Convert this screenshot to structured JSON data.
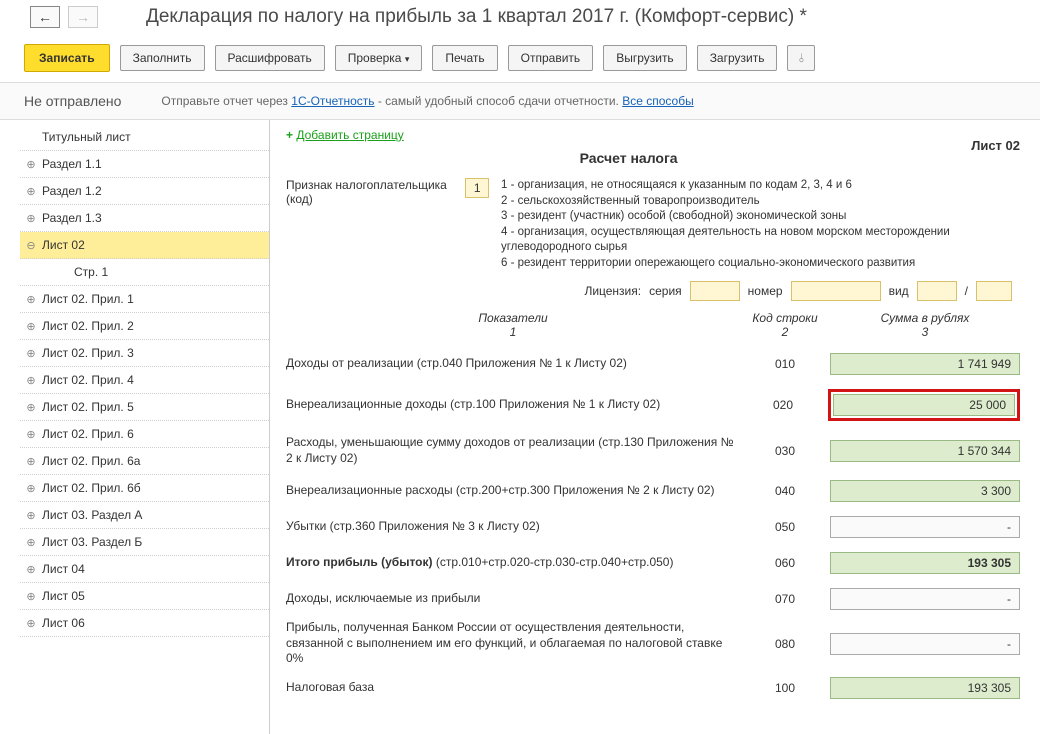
{
  "header": {
    "title": "Декларация по налогу на прибыль за 1 квартал 2017 г. (Комфорт-сервис) *"
  },
  "toolbar": {
    "save": "Записать",
    "fill": "Заполнить",
    "decode": "Расшифровать",
    "check": "Проверка",
    "print": "Печать",
    "send": "Отправить",
    "export": "Выгрузить",
    "import": "Загрузить"
  },
  "status": {
    "left": "Не отправлено",
    "text1": "Отправьте отчет через ",
    "link1": "1С-Отчетность",
    "text2": " - самый удобный способ сдачи отчетности. ",
    "link2": "Все способы"
  },
  "sidebar": {
    "items": [
      "Титульный лист",
      "Раздел 1.1",
      "Раздел 1.2",
      "Раздел 1.3",
      "Лист 02",
      "Стр. 1",
      "Лист 02. Прил. 1",
      "Лист 02. Прил. 2",
      "Лист 02. Прил. 3",
      "Лист 02. Прил. 4",
      "Лист 02. Прил. 5",
      "Лист 02. Прил. 6",
      "Лист 02. Прил. 6а",
      "Лист 02. Прил. 6б",
      "Лист 03. Раздел А",
      "Лист 03. Раздел Б",
      "Лист 04",
      "Лист 05",
      "Лист 06"
    ]
  },
  "content": {
    "add_page": "Добавить страницу",
    "sheet_label": "Лист 02",
    "section_title": "Расчет налога",
    "taxpayer_label": "Признак налогоплательщика (код)",
    "taxpayer_code": "1",
    "codes": {
      "l1": "1 - организация, не относящаяся к указанным по кодам 2, 3, 4 и 6",
      "l2": "2 - сельскохозяйственный товаропроизводитель",
      "l3": "3 - резидент (участник) особой (свободной) экономической зоны",
      "l4": "4 - организация, осуществляющая деятельность на новом морском месторождении углеводородного сырья",
      "l6": "6 - резидент территории опережающего социально-экономического развития"
    },
    "license": {
      "label": "Лицензия:",
      "series": "серия",
      "number": "номер",
      "kind": "вид",
      "slash": "/"
    },
    "colheaders": {
      "c1a": "Показатели",
      "c1b": "1",
      "c2a": "Код строки",
      "c2b": "2",
      "c3a": "Сумма в рублях",
      "c3b": "3"
    },
    "rows": [
      {
        "desc": "Доходы от реализации (стр.040 Приложения № 1 к Листу 02)",
        "code": "010",
        "val": "1 741 949",
        "style": "g"
      },
      {
        "desc": "Внереализационные доходы (стр.100 Приложения № 1 к Листу 02)",
        "code": "020",
        "val": "25 000",
        "style": "hl"
      },
      {
        "desc": "Расходы, уменьшающие сумму доходов от реализации (стр.130 Приложения № 2 к Листу 02)",
        "code": "030",
        "val": "1 570 344",
        "style": "g"
      },
      {
        "desc": "Внереализационные расходы (стр.200+стр.300 Приложения № 2 к Листу 02)",
        "code": "040",
        "val": "3 300",
        "style": "g"
      },
      {
        "desc": "Убытки (стр.360 Приложения № 3 к Листу 02)",
        "code": "050",
        "val": "-",
        "style": "l"
      },
      {
        "desc": "Итого прибыль (убыток)  (стр.010+стр.020-стр.030-стр.040+стр.050)",
        "code": "060",
        "val": "193 305",
        "style": "g",
        "bold": true
      },
      {
        "desc": "Доходы, исключаемые из прибыли",
        "code": "070",
        "val": "-",
        "style": "l"
      },
      {
        "desc": "Прибыль, полученная Банком России от осуществления деятельности, связанной с выполнением им его функций, и облагаемая по налоговой ставке 0%",
        "code": "080",
        "val": "-",
        "style": "l"
      },
      {
        "desc": "Налоговая база",
        "code": "100",
        "val": "193 305",
        "style": "g"
      }
    ]
  }
}
